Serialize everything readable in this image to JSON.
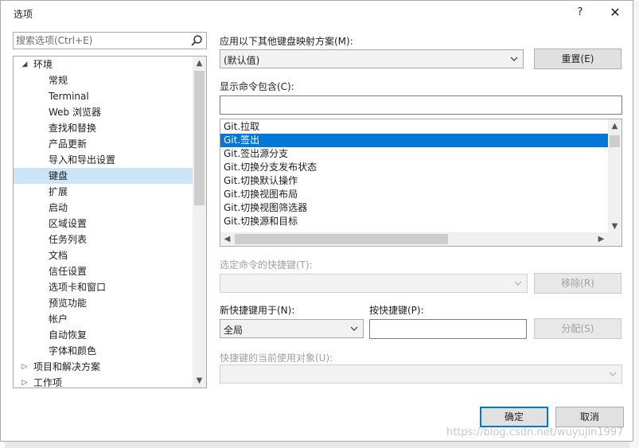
{
  "dialog": {
    "title": "选项",
    "help_label": "?",
    "close_label": "✕"
  },
  "search": {
    "placeholder": "搜索选项(Ctrl+E)"
  },
  "tree": {
    "items": [
      {
        "label": "环境",
        "arrow": "◢",
        "level": 0
      },
      {
        "label": "常规",
        "arrow": "",
        "level": 1
      },
      {
        "label": "Terminal",
        "arrow": "",
        "level": 1
      },
      {
        "label": "Web 浏览器",
        "arrow": "",
        "level": 1
      },
      {
        "label": "查找和替换",
        "arrow": "",
        "level": 1
      },
      {
        "label": "产品更新",
        "arrow": "",
        "level": 1
      },
      {
        "label": "导入和导出设置",
        "arrow": "",
        "level": 1
      },
      {
        "label": "键盘",
        "arrow": "",
        "level": 1,
        "selected": true
      },
      {
        "label": "扩展",
        "arrow": "",
        "level": 1
      },
      {
        "label": "启动",
        "arrow": "",
        "level": 1
      },
      {
        "label": "区域设置",
        "arrow": "",
        "level": 1
      },
      {
        "label": "任务列表",
        "arrow": "",
        "level": 1
      },
      {
        "label": "文档",
        "arrow": "",
        "level": 1
      },
      {
        "label": "信任设置",
        "arrow": "",
        "level": 1
      },
      {
        "label": "选项卡和窗口",
        "arrow": "",
        "level": 1
      },
      {
        "label": "预览功能",
        "arrow": "",
        "level": 1
      },
      {
        "label": "帐户",
        "arrow": "",
        "level": 1
      },
      {
        "label": "自动恢复",
        "arrow": "",
        "level": 1
      },
      {
        "label": "字体和颜色",
        "arrow": "",
        "level": 1
      },
      {
        "label": "项目和解决方案",
        "arrow": "▷",
        "level": 0
      },
      {
        "label": "工作项",
        "arrow": "▷",
        "level": 0
      }
    ]
  },
  "mapping": {
    "label": "应用以下其他键盘映射方案(M):",
    "value": "(默认值)",
    "reset_label": "重置(E)"
  },
  "show_commands": {
    "label": "显示命令包含(C):",
    "value": ""
  },
  "commands": [
    {
      "label": "Git.拉取"
    },
    {
      "label": "Git.签出",
      "selected": true
    },
    {
      "label": "Git.签出源分支"
    },
    {
      "label": "Git.切换分支发布状态"
    },
    {
      "label": "Git.切换默认操作"
    },
    {
      "label": "Git.切换视图布局"
    },
    {
      "label": "Git.切换视图筛选器"
    },
    {
      "label": "Git.切换源和目标"
    }
  ],
  "shortcuts_for_selected": {
    "label": "选定命令的快捷键(T):",
    "value": "",
    "remove_label": "移除(R)"
  },
  "use_new_shortcut": {
    "label": "新快捷键用于(N):",
    "value": "全局"
  },
  "press_keys": {
    "label": "按快捷键(P):",
    "value": "",
    "assign_label": "分配(S)"
  },
  "currently_used_by": {
    "label": "快捷键的当前使用对象(U):",
    "value": ""
  },
  "footer": {
    "ok_label": "确定",
    "cancel_label": "取消"
  },
  "watermark": "https://blog.csdn.net/wuyujin1997",
  "colors": {
    "selection_blue": "#0078d7",
    "tree_selection": "#cce4f7"
  }
}
